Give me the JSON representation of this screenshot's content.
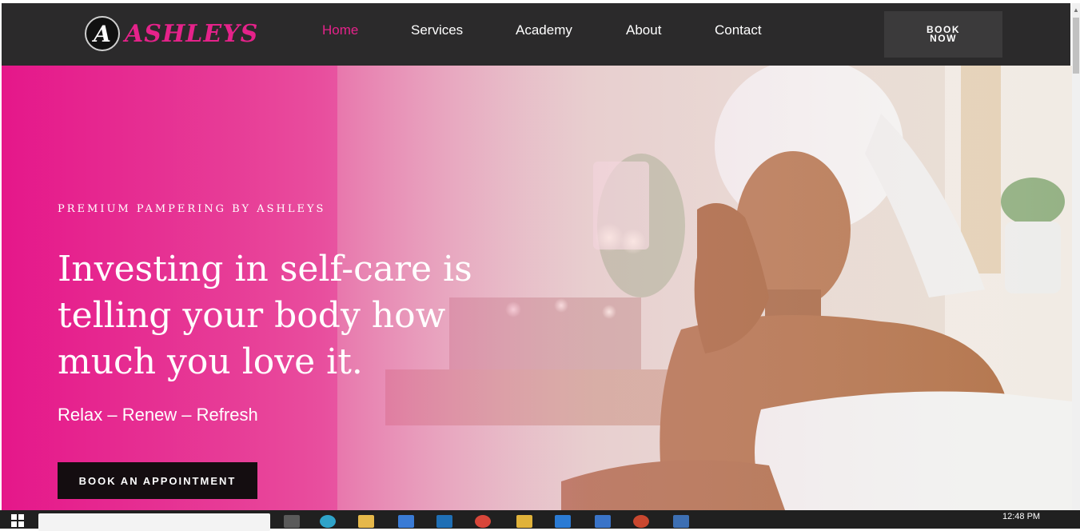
{
  "nav": {
    "logo_badge": "A",
    "logo_text": "ASHLEYS",
    "links": [
      "Home",
      "Services",
      "Academy",
      "About",
      "Contact"
    ],
    "book_now": "BOOK NOW",
    "active_color": "#e5228a"
  },
  "hero": {
    "eyebrow": "PREMIUM PAMPERING BY ASHLEYS",
    "headline": "Investing in self-care is telling your body how much you love it.",
    "tagline": "Relax – Renew – Refresh",
    "cta": "BOOK AN APPOINTMENT",
    "gradient_color": "#e5178a"
  },
  "taskbar": {
    "time": "12:48 PM"
  }
}
